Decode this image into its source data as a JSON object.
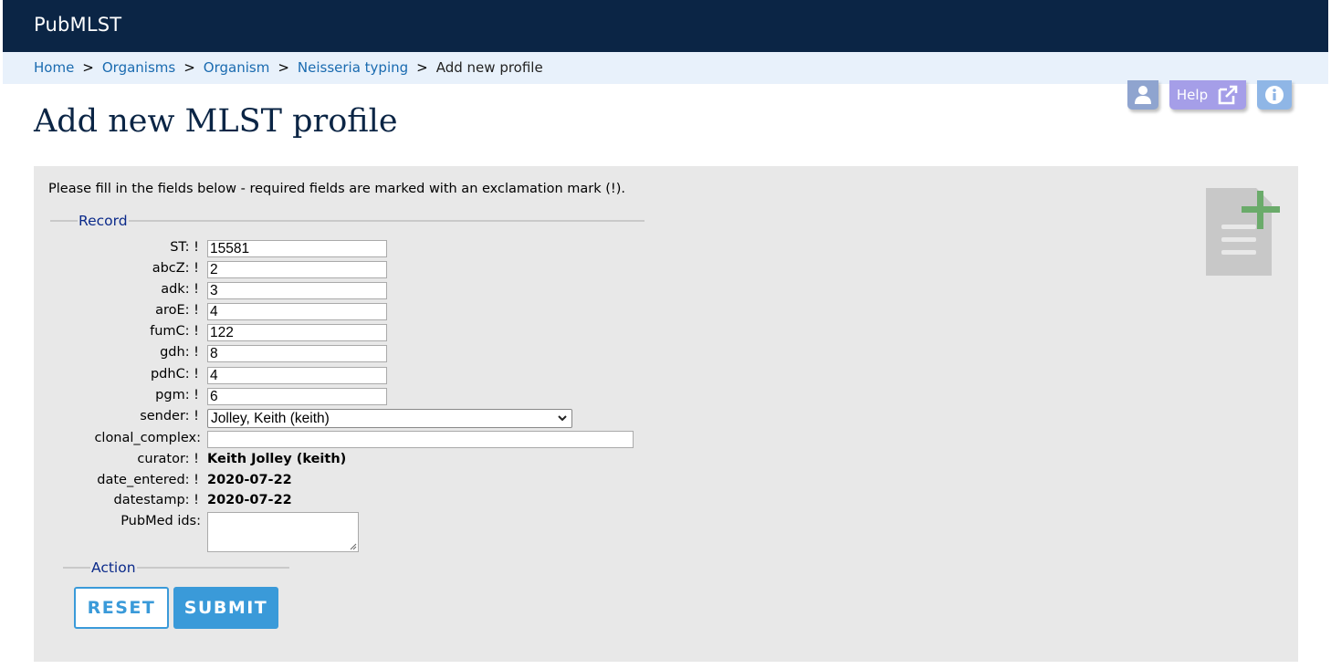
{
  "header": {
    "brand": "PubMLST"
  },
  "breadcrumb": {
    "items": [
      "Home",
      "Organisms",
      "Organism",
      "Neisseria typing"
    ],
    "separator": ">",
    "current": "Add new profile"
  },
  "toolbar": {
    "help_label": "Help",
    "user_icon": "user-icon",
    "external_icon": "external-link-icon",
    "info_icon": "info-icon"
  },
  "page": {
    "title": "Add new MLST profile"
  },
  "form": {
    "intro": "Please fill in the fields below - required fields are marked with an exclamation mark (!).",
    "record_legend": "Record",
    "action_legend": "Action",
    "fields": [
      {
        "label": "ST: !",
        "value": "15581"
      },
      {
        "label": "abcZ: !",
        "value": "2"
      },
      {
        "label": "adk: !",
        "value": "3"
      },
      {
        "label": "aroE: !",
        "value": "4"
      },
      {
        "label": "fumC: !",
        "value": "122"
      },
      {
        "label": "gdh: !",
        "value": "8"
      },
      {
        "label": "pdhC: !",
        "value": "4"
      },
      {
        "label": "pgm: !",
        "value": "6"
      }
    ],
    "sender": {
      "label": "sender: !",
      "selected": "Jolley, Keith (keith)"
    },
    "clonal_complex": {
      "label": "clonal_complex:",
      "value": ""
    },
    "curator": {
      "label": "curator: !",
      "value": "Keith Jolley (keith)"
    },
    "date_entered": {
      "label": "date_entered: !",
      "value": "2020-07-22"
    },
    "datestamp": {
      "label": "datestamp: !",
      "value": "2020-07-22"
    },
    "pubmed": {
      "label": "PubMed ids:",
      "value": ""
    },
    "reset_label": "RESET",
    "submit_label": "SUBMIT"
  },
  "colors": {
    "header_bg": "#0b2545",
    "breadcrumb_bg": "#e8f1fb",
    "panel_bg": "#e8e8e8",
    "accent": "#3a9ad9",
    "add_icon": "#6aab6a"
  }
}
